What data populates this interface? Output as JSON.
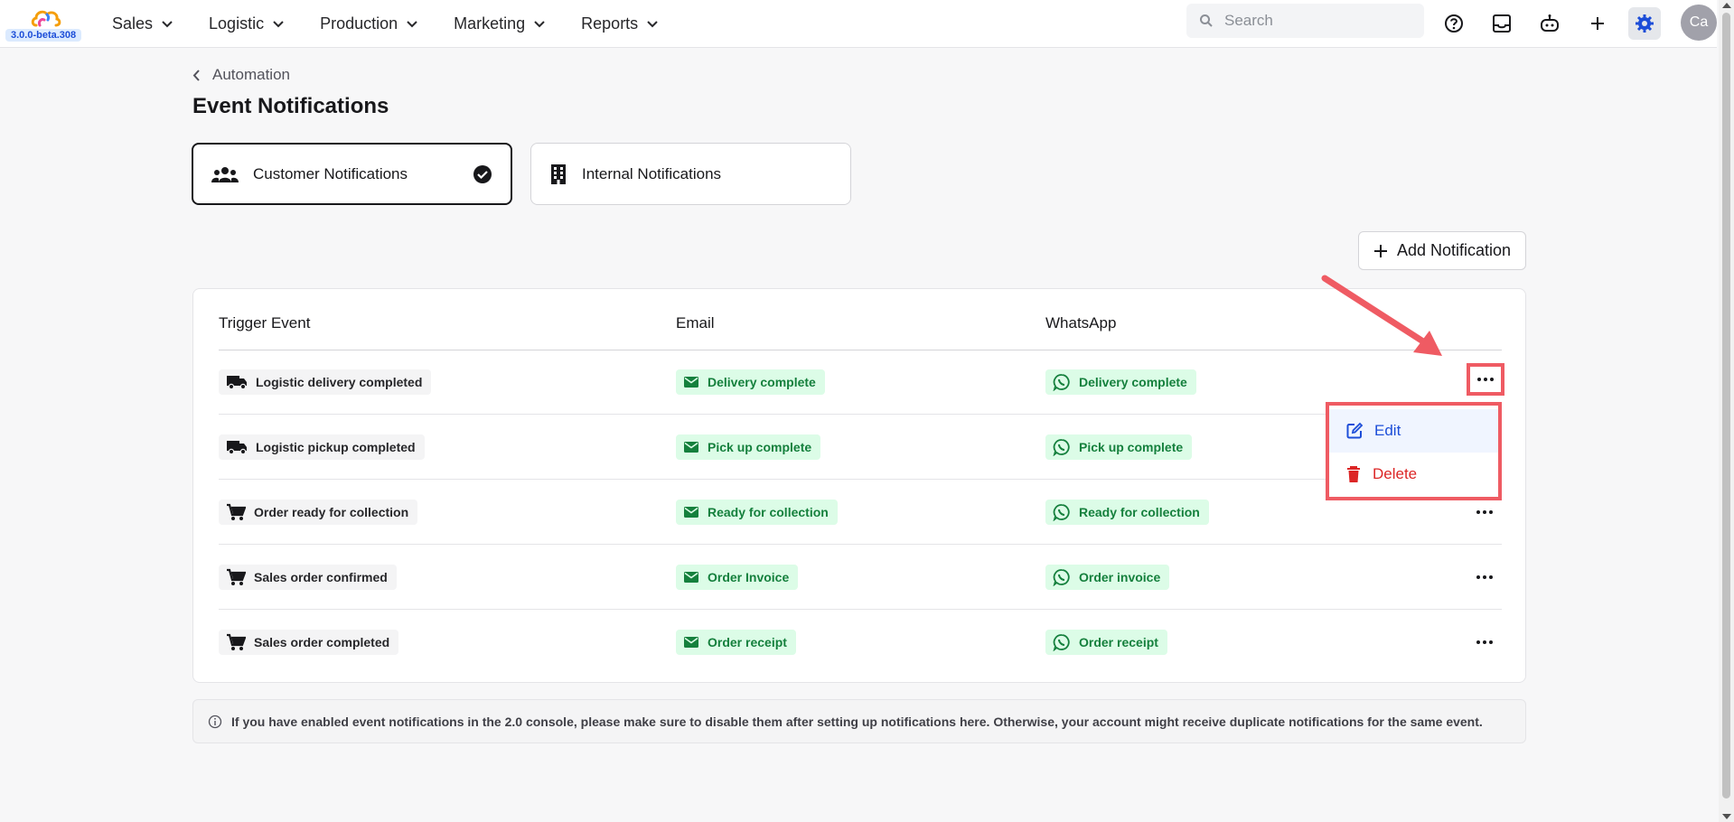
{
  "app": {
    "version": "3.0.0-beta.308"
  },
  "nav": [
    {
      "label": "Sales"
    },
    {
      "label": "Logistic"
    },
    {
      "label": "Production"
    },
    {
      "label": "Marketing"
    },
    {
      "label": "Reports"
    }
  ],
  "search": {
    "placeholder": "Search"
  },
  "user": {
    "initials": "Ca"
  },
  "breadcrumb": {
    "label": "Automation"
  },
  "page": {
    "title": "Event Notifications"
  },
  "tabs": [
    {
      "label": "Customer Notifications",
      "selected": true
    },
    {
      "label": "Internal Notifications",
      "selected": false
    }
  ],
  "actions": {
    "add_label": "Add Notification"
  },
  "table": {
    "headers": {
      "trigger": "Trigger Event",
      "email": "Email",
      "whatsapp": "WhatsApp"
    },
    "rows": [
      {
        "trigger": "Logistic delivery completed",
        "trigger_icon": "truck-icon",
        "email": "Delivery complete",
        "whatsapp": "Delivery complete"
      },
      {
        "trigger": "Logistic pickup completed",
        "trigger_icon": "truck-icon",
        "email": "Pick up complete",
        "whatsapp": "Pick up complete"
      },
      {
        "trigger": "Order ready for collection",
        "trigger_icon": "cart-icon",
        "email": "Ready for collection",
        "whatsapp": "Ready for collection"
      },
      {
        "trigger": "Sales order confirmed",
        "trigger_icon": "cart-icon",
        "email": "Order Invoice",
        "whatsapp": "Order invoice"
      },
      {
        "trigger": "Sales order completed",
        "trigger_icon": "cart-icon",
        "email": "Order receipt",
        "whatsapp": "Order receipt"
      }
    ]
  },
  "menu": {
    "edit_label": "Edit",
    "delete_label": "Delete"
  },
  "info": {
    "text": "If you have enabled event notifications in the 2.0 console, please make sure to disable them after setting up notifications here. Otherwise, your account might receive duplicate notifications for the same event."
  },
  "colors": {
    "accent": "#1d4ed8",
    "success": "#15803d",
    "danger": "#dc2626",
    "highlight": "#ef5b63"
  }
}
